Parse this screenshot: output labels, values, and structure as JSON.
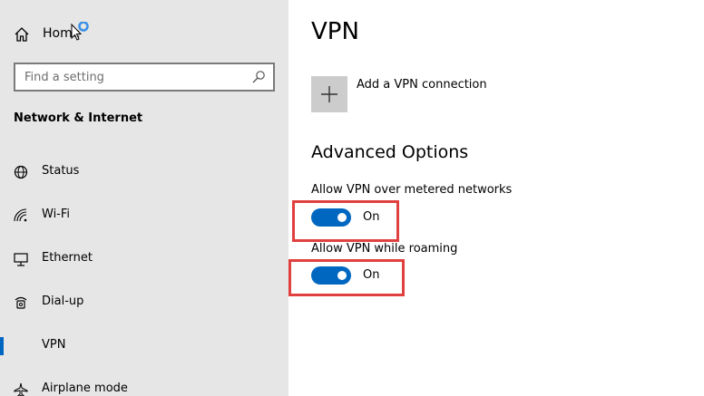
{
  "sidebar": {
    "home_label": "Home",
    "search_placeholder": "Find a setting",
    "section_title": "Network & Internet",
    "items": [
      {
        "label": "Status",
        "icon": "status-globe-icon"
      },
      {
        "label": "Wi-Fi",
        "icon": "wifi-icon"
      },
      {
        "label": "Ethernet",
        "icon": "ethernet-icon"
      },
      {
        "label": "Dial-up",
        "icon": "dial-up-icon"
      },
      {
        "label": "VPN",
        "icon": "vpn-icon",
        "selected": true
      },
      {
        "label": "Airplane mode",
        "icon": "airplane-icon"
      }
    ]
  },
  "main": {
    "title": "VPN",
    "add_connection_label": "Add a VPN connection",
    "advanced_title": "Advanced Options",
    "options": [
      {
        "label": "Allow VPN over metered networks",
        "state": "On"
      },
      {
        "label": "Allow VPN while roaming",
        "state": "On"
      }
    ]
  },
  "colors": {
    "accent": "#0067c0",
    "sidebar_bg": "#e6e6e6",
    "highlight": "#e0403f",
    "add_button_bg": "#cccccc"
  }
}
